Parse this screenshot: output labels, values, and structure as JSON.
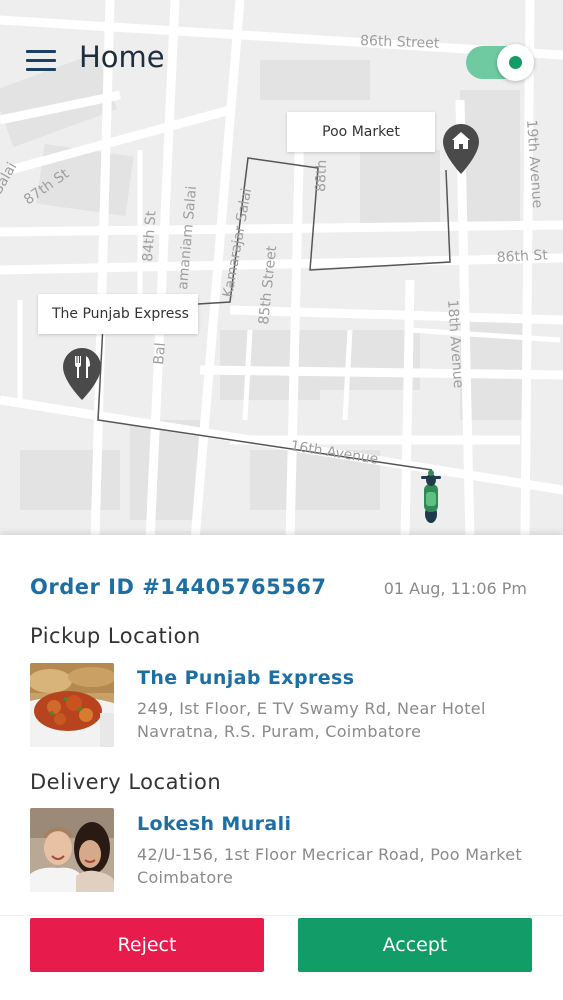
{
  "header": {
    "title": "Home",
    "online_toggle": "on"
  },
  "map": {
    "streets": {
      "s86th_top": "86th Street",
      "s87th": "87th St",
      "salai_left": "Salai",
      "s84th": "84th St",
      "manium": "amaniam Salai",
      "kamarajar": "Kamarajar Salai",
      "s85th": "85th Street",
      "s88th": "88th",
      "s19th": "19th Avenue",
      "s86th_right": "86th St",
      "s18th": "18th Avenue",
      "s16th": "16th Avenue",
      "bal": "Bal"
    },
    "pickup_tag": "The Punjab Express",
    "drop_tag": "Poo Market"
  },
  "order": {
    "id": "Order ID #14405765567",
    "time": "01 Aug, 11:06 Pm"
  },
  "pickup": {
    "title": "Pickup Location",
    "name": "The Punjab Express",
    "address": "249, Ist Floor, E TV Swamy Rd, Near Hotel Navratna, R.S. Puram, Coimbatore"
  },
  "delivery": {
    "title": "Delivery Location",
    "name": "Lokesh Murali",
    "address": "42/U-156, 1st Floor Mecricar Road, Poo Market Coimbatore"
  },
  "actions": {
    "reject": "Reject",
    "accept": "Accept"
  },
  "colors": {
    "accent_blue": "#1d6fa3",
    "reject_red": "#e81b4d",
    "accept_green": "#129c68"
  }
}
